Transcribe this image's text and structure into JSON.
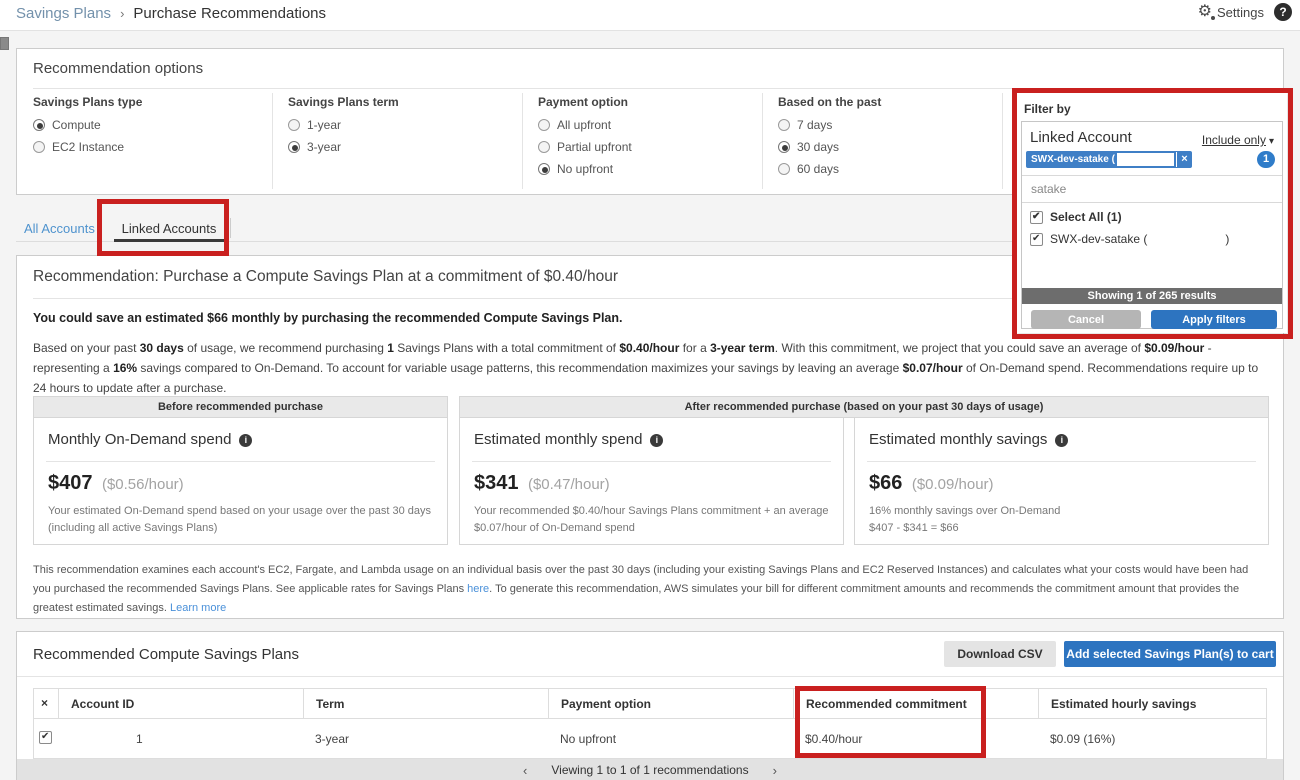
{
  "breadcrumb": {
    "parent": "Savings Plans",
    "current": "Purchase Recommendations"
  },
  "topbar": {
    "settings_label": "Settings"
  },
  "icons": {
    "settings": "⚙",
    "help": "?",
    "caret": "▾",
    "close": "×",
    "prev": "‹",
    "next": "›",
    "sep": "›",
    "info": "i"
  },
  "options": {
    "title": "Recommendation options",
    "groups": [
      {
        "label": "Savings Plans type",
        "items": [
          {
            "label": "Compute",
            "selected": true
          },
          {
            "label": "EC2 Instance",
            "selected": false
          }
        ]
      },
      {
        "label": "Savings Plans term",
        "items": [
          {
            "label": "1-year",
            "selected": false
          },
          {
            "label": "3-year",
            "selected": true
          }
        ]
      },
      {
        "label": "Payment option",
        "items": [
          {
            "label": "All upfront",
            "selected": false
          },
          {
            "label": "Partial upfront",
            "selected": false
          },
          {
            "label": "No upfront",
            "selected": true
          }
        ]
      },
      {
        "label": "Based on the past",
        "items": [
          {
            "label": "7 days",
            "selected": false
          },
          {
            "label": "30 days",
            "selected": true
          },
          {
            "label": "60 days",
            "selected": false
          }
        ]
      }
    ]
  },
  "filter": {
    "title": "Filter by",
    "field_label": "Linked Account",
    "mode": "Include only",
    "tag_text": "SWX-dev-satake (",
    "badge": "1",
    "search_value": "satake",
    "select_all": "Select All (1)",
    "option_prefix": "SWX-dev-satake (",
    "option_suffix": ")",
    "results": "Showing 1 of 265 results",
    "cancel": "Cancel",
    "apply": "Apply filters"
  },
  "tabs": {
    "all": "All Accounts",
    "linked": "Linked Accounts"
  },
  "recommendation": {
    "title": "Recommendation: Purchase a Compute Savings Plan at a commitment of $0.40/hour",
    "summary": "You could save an estimated $66 monthly by purchasing the recommended Compute Savings Plan.",
    "body_segments": [
      {
        "t": "Based on your past "
      },
      {
        "t": "30 days",
        "b": 1
      },
      {
        "t": " of usage, we recommend purchasing "
      },
      {
        "t": "1",
        "b": 1
      },
      {
        "t": " Savings Plans with a total commitment of "
      },
      {
        "t": "$0.40/hour",
        "b": 1
      },
      {
        "t": " for a "
      },
      {
        "t": "3-year term",
        "b": 1
      },
      {
        "t": ". With this commitment, we project that you could save an average of "
      },
      {
        "t": "$0.09/hour",
        "b": 1
      },
      {
        "t": " - representing a "
      },
      {
        "t": "16%",
        "b": 1
      },
      {
        "t": " savings compared to On-Demand. To account for variable usage patterns, this recommendation maximizes your savings by leaving an average "
      },
      {
        "t": "$0.07/hour",
        "b": 1
      },
      {
        "t": " of On-Demand spend. Recommendations require up to 24 hours to update after a purchase."
      }
    ]
  },
  "cards": {
    "before_header": "Before recommended purchase",
    "after_header": "After recommended purchase (based on your past 30 days of usage)",
    "before": {
      "title": "Monthly On-Demand spend",
      "amount": "$407",
      "rate": "($0.56/hour)",
      "desc": "Your estimated On-Demand spend based on your usage over the past 30 days (including all active Savings Plans)"
    },
    "spend": {
      "title": "Estimated monthly spend",
      "amount": "$341",
      "rate": "($0.47/hour)",
      "desc": "Your recommended $0.40/hour Savings Plans commitment + an average $0.07/hour of On-Demand spend"
    },
    "savings": {
      "title": "Estimated monthly savings",
      "amount": "$66",
      "rate": "($0.09/hour)",
      "desc": "16% monthly savings over On-Demand",
      "desc2": "$407 - $341 = $66"
    }
  },
  "fine_print_segments": [
    {
      "t": "This recommendation examines each account's EC2, Fargate, and Lambda usage on an individual basis over the past 30 days (including your existing Savings Plans and EC2 Reserved Instances) and calculates what your costs would have been had you purchased the recommended Savings Plans. See applicable rates for Savings Plans "
    },
    {
      "t": "here",
      "l": 1
    },
    {
      "t": ". To generate this recommendation, AWS simulates your bill for different commitment amounts and recommends the commitment amount that provides the greatest estimated savings. "
    },
    {
      "t": "Learn more",
      "l": 1
    }
  ],
  "table": {
    "title": "Recommended Compute Savings Plans",
    "download_label": "Download CSV",
    "cart_label": "Add selected Savings Plan(s) to cart",
    "columns": [
      "×",
      "Account ID",
      "Term",
      "Payment option",
      "Recommended commitment",
      "Estimated hourly savings"
    ],
    "row": {
      "account_id": "1",
      "term": "3-year",
      "payment": "No upfront",
      "commitment": "$0.40/hour",
      "savings": "$0.09 (16%)"
    },
    "pagination": "Viewing 1 to 1 of 1 recommendations"
  }
}
